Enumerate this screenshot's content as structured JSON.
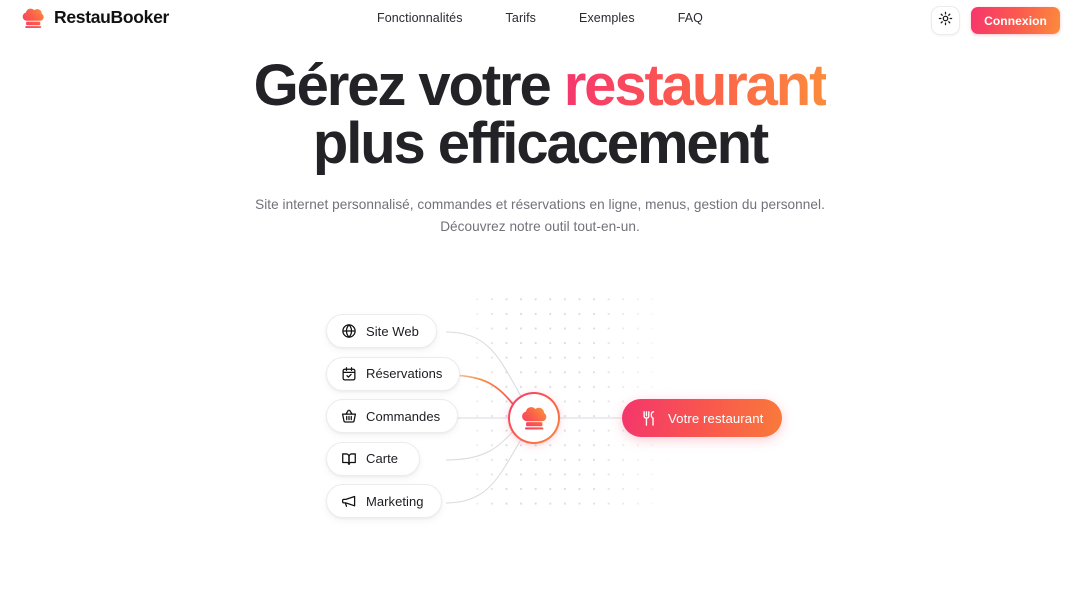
{
  "header": {
    "brand": {
      "name": "RestauBooker",
      "icon": "chef-hat-icon"
    },
    "nav": [
      {
        "label": "Fonctionnalités"
      },
      {
        "label": "Tarifs"
      },
      {
        "label": "Exemples"
      },
      {
        "label": "FAQ"
      }
    ],
    "theme_toggle": {
      "icon": "sun-icon",
      "title": "Thème clair"
    },
    "login": {
      "label": "Connexion"
    }
  },
  "hero": {
    "title_part1": "Gérez votre ",
    "title_accent": "restaurant",
    "title_line2": "plus efficacement",
    "subtitle_line1": "Site internet personnalisé, commandes et réservations en ligne, menus, gestion du personnel.",
    "subtitle_line2": "Découvrez notre outil tout-en-un."
  },
  "diagram": {
    "features": [
      {
        "label": "Site Web",
        "icon": "globe-icon"
      },
      {
        "label": "Réservations",
        "icon": "calendar-check-icon"
      },
      {
        "label": "Commandes",
        "icon": "shopping-basket-icon"
      },
      {
        "label": "Carte",
        "icon": "book-open-icon"
      },
      {
        "label": "Marketing",
        "icon": "megaphone-icon"
      }
    ],
    "hub": {
      "icon": "chef-hat-icon"
    },
    "target": {
      "label": "Votre restaurant",
      "icon": "utensils-icon"
    }
  },
  "colors": {
    "gradient_start": "#f4366c",
    "gradient_mid": "#fb5c4c",
    "gradient_end": "#fb8b3c",
    "text_primary": "#232327",
    "text_muted": "#71717a",
    "background": "#ffffff",
    "dot_grid": "#c9c9d2"
  }
}
